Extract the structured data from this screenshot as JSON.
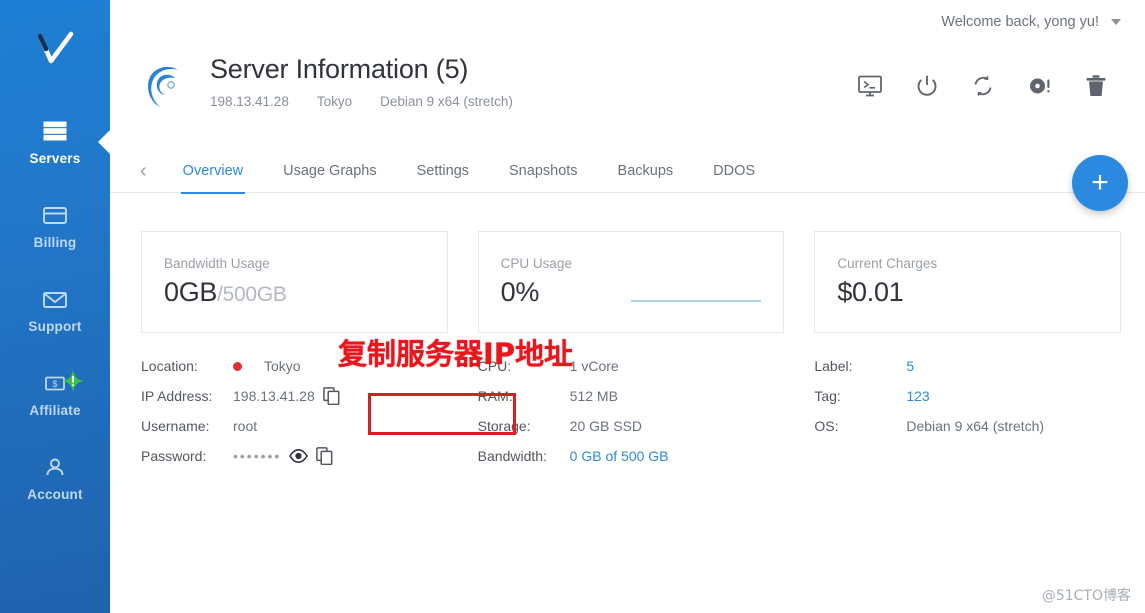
{
  "sidebar": {
    "logo_name": "vultr-checkmark-logo",
    "items": [
      {
        "label": "Servers",
        "icon": "server-list-icon",
        "active": true,
        "badge": ""
      },
      {
        "label": "Billing",
        "icon": "credit-card-icon",
        "active": false,
        "badge": ""
      },
      {
        "label": "Support",
        "icon": "envelope-icon",
        "active": false,
        "badge": ""
      },
      {
        "label": "Affiliate",
        "icon": "money-bill-icon",
        "active": false,
        "badge": "!"
      },
      {
        "label": "Account",
        "icon": "user-icon",
        "active": false,
        "badge": ""
      }
    ]
  },
  "topbar": {
    "welcome": "Welcome back, yong yu!"
  },
  "header": {
    "os_logo": "debian-swirl-logo",
    "title": "Server Information (5)",
    "meta": [
      "198.13.41.28",
      "Tokyo",
      "Debian 9 x64 (stretch)"
    ],
    "actions": [
      {
        "name": "console-icon",
        "title": "Console"
      },
      {
        "name": "power-icon",
        "title": "Power"
      },
      {
        "name": "restart-icon",
        "title": "Restart"
      },
      {
        "name": "reinstall-icon",
        "title": "Reinstall"
      },
      {
        "name": "delete-icon",
        "title": "Destroy"
      }
    ]
  },
  "tabs": {
    "prev_arrow": "‹",
    "next_arrow": "›",
    "items": [
      {
        "label": "Overview",
        "active": true
      },
      {
        "label": "Usage Graphs",
        "active": false
      },
      {
        "label": "Settings",
        "active": false
      },
      {
        "label": "Snapshots",
        "active": false
      },
      {
        "label": "Backups",
        "active": false
      },
      {
        "label": "DDOS",
        "active": false
      }
    ]
  },
  "fab": {
    "label": "+"
  },
  "cards": [
    {
      "label": "Bandwidth Usage",
      "value": "0GB",
      "suffix": "/500GB",
      "spark": false
    },
    {
      "label": "CPU Usage",
      "value": "0%",
      "suffix": "",
      "spark": true
    },
    {
      "label": "Current Charges",
      "value": "$0.01",
      "suffix": "",
      "spark": false
    }
  ],
  "details": {
    "left": [
      {
        "key": "Location:",
        "value": "Tokyo",
        "flag": true,
        "link": false,
        "copy": false,
        "eye": false,
        "password": false
      },
      {
        "key": "IP Address:",
        "value": "198.13.41.28",
        "flag": false,
        "link": false,
        "copy": true,
        "eye": false,
        "password": false
      },
      {
        "key": "Username:",
        "value": "root",
        "flag": false,
        "link": false,
        "copy": false,
        "eye": false,
        "password": false
      },
      {
        "key": "Password:",
        "value": "•••••••",
        "flag": false,
        "link": false,
        "copy": true,
        "eye": true,
        "password": true
      }
    ],
    "middle": [
      {
        "key": "CPU:",
        "value": "1 vCore",
        "link": false
      },
      {
        "key": "RAM:",
        "value": "512 MB",
        "link": false
      },
      {
        "key": "Storage:",
        "value": "20 GB SSD",
        "link": false
      },
      {
        "key": "Bandwidth:",
        "value": "0 GB of 500 GB",
        "link": true
      }
    ],
    "right": [
      {
        "key": "Label:",
        "value": "5",
        "link": true
      },
      {
        "key": "Tag:",
        "value": "123",
        "link": true
      },
      {
        "key": "OS:",
        "value": "Debian 9 x64 (stretch)",
        "link": false
      }
    ]
  },
  "annotations": {
    "text": "复制服务器IP地址",
    "box_target": "ip-address-row",
    "color": "#e8161d"
  },
  "watermark": "@51CTO博客",
  "colors": {
    "sidebar_top": "#1e7fd4",
    "sidebar_bottom": "#1f62ad",
    "accent": "#2b8ae0",
    "annotation_red": "#e8161d",
    "badge_green": "#3ec13e"
  }
}
